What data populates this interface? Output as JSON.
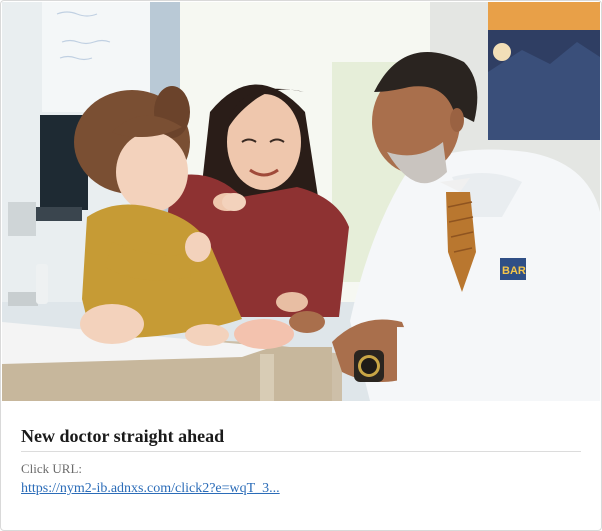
{
  "ad": {
    "headline": "New doctor straight ahead",
    "click_url_label": "Click URL:",
    "click_url_text": "https://nym2-ib.adnxs.com/click2?e=wqT_3...",
    "image_alt": "Doctor in white coat speaking with a mother and toddler on an exam table",
    "coat_badge_text": "BAR"
  },
  "colors": {
    "link": "#2b6cb8",
    "headline": "#1a1a1a",
    "muted": "#6b6b6b",
    "border": "#d9d9d9"
  }
}
